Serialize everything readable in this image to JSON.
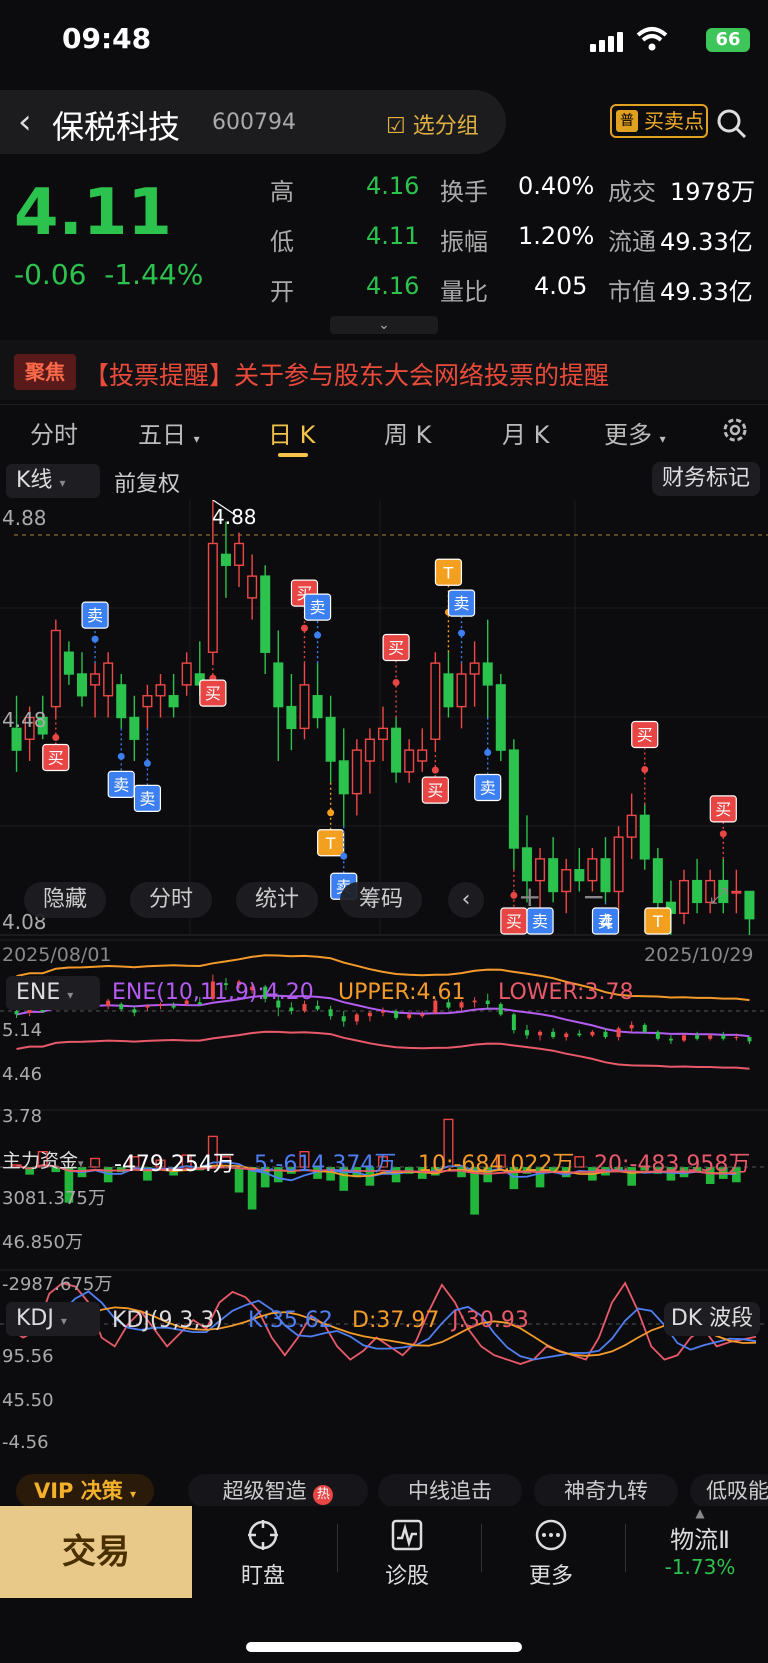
{
  "status": {
    "time": "09:48",
    "battery": "66"
  },
  "header": {
    "stock_name": "保税科技",
    "stock_code": "600794",
    "group_label": "选分组",
    "bs_tag": "普",
    "bs_label": "买卖点"
  },
  "quote": {
    "price": "4.11",
    "change": "-0.06",
    "change_pct": "-1.44%",
    "stats": [
      {
        "label": "高",
        "value": "4.16",
        "label2": "换手",
        "value2": "0.40%",
        "label3": "成交",
        "value3": "1978万"
      },
      {
        "label": "低",
        "value": "4.11",
        "label2": "振幅",
        "value2": "1.20%",
        "label3": "流通",
        "value3": "49.33亿"
      },
      {
        "label": "开",
        "value": "4.16",
        "label2": "量比",
        "value2": "4.05",
        "label3": "市值",
        "value3": "49.33亿"
      }
    ]
  },
  "news": {
    "badge": "聚焦",
    "text": "【投票提醒】关于参与股东大会网络投票的提醒"
  },
  "tabs": [
    {
      "label": "分时"
    },
    {
      "label": "五日"
    },
    {
      "label": "日 K"
    },
    {
      "label": "周 K"
    },
    {
      "label": "月 K"
    },
    {
      "label": "更多"
    }
  ],
  "ksub": {
    "type": "K线",
    "adjust": "前复权",
    "finance": "财务标记"
  },
  "kline": {
    "y_max": "4.88",
    "y_mid": "4.48",
    "y_min": "4.08",
    "hi_label": "4.88",
    "lo_label": "4",
    "date_start": "2025/08/01",
    "date_end": "2025/10/29",
    "overlay": [
      "隐藏",
      "分时",
      "统计",
      "筹码"
    ],
    "buy": "买",
    "sell": "卖",
    "t": "T"
  },
  "ene": {
    "name": "ENE",
    "params": "ENE(10,11,9):4.20",
    "upper": "UPPER:4.61",
    "lower": "LOWER:3.78",
    "y_top": "5.14",
    "y_mid": "4.46",
    "y_bot": "3.78"
  },
  "capital": {
    "name": "主力资金",
    "v": "-479.254万",
    "v5": "5:-614.374万",
    "v10": "10:-684.022万",
    "v20": "20:-483.958万",
    "y_top": "3081.375万",
    "y_mid": "46.850万",
    "y_bot": "-2987.675万"
  },
  "kdj": {
    "name": "KDJ",
    "params": "KDJ(9,3,3)",
    "k": "K:35.62",
    "d": "D:37.97",
    "j": "J:30.93",
    "btn": "DK 波段",
    "y_top": "95.56",
    "y_mid": "45.50",
    "y_bot": "-4.56"
  },
  "vip": {
    "label": "VIP 决策",
    "chips": [
      "超级智造",
      "中线追击",
      "神奇九转",
      "低吸能"
    ],
    "hot": "热"
  },
  "bottom": {
    "trade": "交易",
    "items": [
      "盯盘",
      "诊股",
      "更多"
    ],
    "sector": "物流Ⅱ",
    "sector_chg": "-1.73%"
  },
  "chart_data": {
    "type": "candlestick",
    "x_range": [
      "2025/08/01",
      "2025/10/29"
    ],
    "ylim": [
      4.08,
      4.88
    ],
    "candles": [
      {
        "o": 4.46,
        "h": 4.52,
        "l": 4.38,
        "c": 4.42
      },
      {
        "o": 4.44,
        "h": 4.5,
        "l": 4.4,
        "c": 4.48
      },
      {
        "o": 4.48,
        "h": 4.52,
        "l": 4.44,
        "c": 4.45
      },
      {
        "o": 4.5,
        "h": 4.66,
        "l": 4.48,
        "c": 4.64
      },
      {
        "o": 4.6,
        "h": 4.62,
        "l": 4.54,
        "c": 4.56
      },
      {
        "o": 4.56,
        "h": 4.6,
        "l": 4.5,
        "c": 4.52
      },
      {
        "o": 4.54,
        "h": 4.58,
        "l": 4.48,
        "c": 4.56
      },
      {
        "o": 4.52,
        "h": 4.6,
        "l": 4.48,
        "c": 4.58
      },
      {
        "o": 4.54,
        "h": 4.56,
        "l": 4.46,
        "c": 4.48
      },
      {
        "o": 4.48,
        "h": 4.52,
        "l": 4.4,
        "c": 4.44
      },
      {
        "o": 4.5,
        "h": 4.54,
        "l": 4.46,
        "c": 4.52
      },
      {
        "o": 4.52,
        "h": 4.56,
        "l": 4.48,
        "c": 4.54
      },
      {
        "o": 4.52,
        "h": 4.56,
        "l": 4.48,
        "c": 4.5
      },
      {
        "o": 4.54,
        "h": 4.6,
        "l": 4.52,
        "c": 4.58
      },
      {
        "o": 4.56,
        "h": 4.62,
        "l": 4.52,
        "c": 4.54
      },
      {
        "o": 4.6,
        "h": 4.88,
        "l": 4.58,
        "c": 4.8
      },
      {
        "o": 4.78,
        "h": 4.84,
        "l": 4.7,
        "c": 4.76
      },
      {
        "o": 4.76,
        "h": 4.82,
        "l": 4.72,
        "c": 4.8
      },
      {
        "o": 4.7,
        "h": 4.78,
        "l": 4.66,
        "c": 4.74
      },
      {
        "o": 4.74,
        "h": 4.76,
        "l": 4.56,
        "c": 4.6
      },
      {
        "o": 4.58,
        "h": 4.64,
        "l": 4.4,
        "c": 4.5
      },
      {
        "o": 4.5,
        "h": 4.56,
        "l": 4.42,
        "c": 4.46
      },
      {
        "o": 4.46,
        "h": 4.58,
        "l": 4.44,
        "c": 4.54
      },
      {
        "o": 4.52,
        "h": 4.58,
        "l": 4.46,
        "c": 4.48
      },
      {
        "o": 4.48,
        "h": 4.52,
        "l": 4.36,
        "c": 4.4
      },
      {
        "o": 4.4,
        "h": 4.46,
        "l": 4.28,
        "c": 4.34
      },
      {
        "o": 4.34,
        "h": 4.44,
        "l": 4.3,
        "c": 4.42
      },
      {
        "o": 4.4,
        "h": 4.46,
        "l": 4.34,
        "c": 4.44
      },
      {
        "o": 4.44,
        "h": 4.5,
        "l": 4.4,
        "c": 4.46
      },
      {
        "o": 4.46,
        "h": 4.48,
        "l": 4.36,
        "c": 4.38
      },
      {
        "o": 4.38,
        "h": 4.44,
        "l": 4.36,
        "c": 4.42
      },
      {
        "o": 4.4,
        "h": 4.46,
        "l": 4.38,
        "c": 4.42
      },
      {
        "o": 4.44,
        "h": 4.6,
        "l": 4.42,
        "c": 4.58
      },
      {
        "o": 4.56,
        "h": 4.6,
        "l": 4.48,
        "c": 4.5
      },
      {
        "o": 4.5,
        "h": 4.58,
        "l": 4.46,
        "c": 4.56
      },
      {
        "o": 4.56,
        "h": 4.62,
        "l": 4.5,
        "c": 4.58
      },
      {
        "o": 4.58,
        "h": 4.66,
        "l": 4.48,
        "c": 4.54
      },
      {
        "o": 4.54,
        "h": 4.56,
        "l": 4.4,
        "c": 4.42
      },
      {
        "o": 4.42,
        "h": 4.44,
        "l": 4.2,
        "c": 4.24
      },
      {
        "o": 4.24,
        "h": 4.3,
        "l": 4.14,
        "c": 4.18
      },
      {
        "o": 4.18,
        "h": 4.24,
        "l": 4.12,
        "c": 4.22
      },
      {
        "o": 4.22,
        "h": 4.26,
        "l": 4.14,
        "c": 4.16
      },
      {
        "o": 4.16,
        "h": 4.22,
        "l": 4.12,
        "c": 4.2
      },
      {
        "o": 4.2,
        "h": 4.24,
        "l": 4.16,
        "c": 4.18
      },
      {
        "o": 4.18,
        "h": 4.24,
        "l": 4.16,
        "c": 4.22
      },
      {
        "o": 4.22,
        "h": 4.26,
        "l": 4.14,
        "c": 4.16
      },
      {
        "o": 4.16,
        "h": 4.28,
        "l": 4.12,
        "c": 4.26
      },
      {
        "o": 4.26,
        "h": 4.34,
        "l": 4.22,
        "c": 4.3
      },
      {
        "o": 4.3,
        "h": 4.32,
        "l": 4.2,
        "c": 4.22
      },
      {
        "o": 4.22,
        "h": 4.24,
        "l": 4.12,
        "c": 4.14
      },
      {
        "o": 4.14,
        "h": 4.18,
        "l": 4.08,
        "c": 4.12
      },
      {
        "o": 4.12,
        "h": 4.2,
        "l": 4.1,
        "c": 4.18
      },
      {
        "o": 4.18,
        "h": 4.22,
        "l": 4.12,
        "c": 4.14
      },
      {
        "o": 4.14,
        "h": 4.2,
        "l": 4.12,
        "c": 4.18
      },
      {
        "o": 4.18,
        "h": 4.22,
        "l": 4.12,
        "c": 4.14
      },
      {
        "o": 4.16,
        "h": 4.2,
        "l": 4.12,
        "c": 4.16
      },
      {
        "o": 4.16,
        "h": 4.16,
        "l": 4.08,
        "c": 4.11
      }
    ]
  }
}
